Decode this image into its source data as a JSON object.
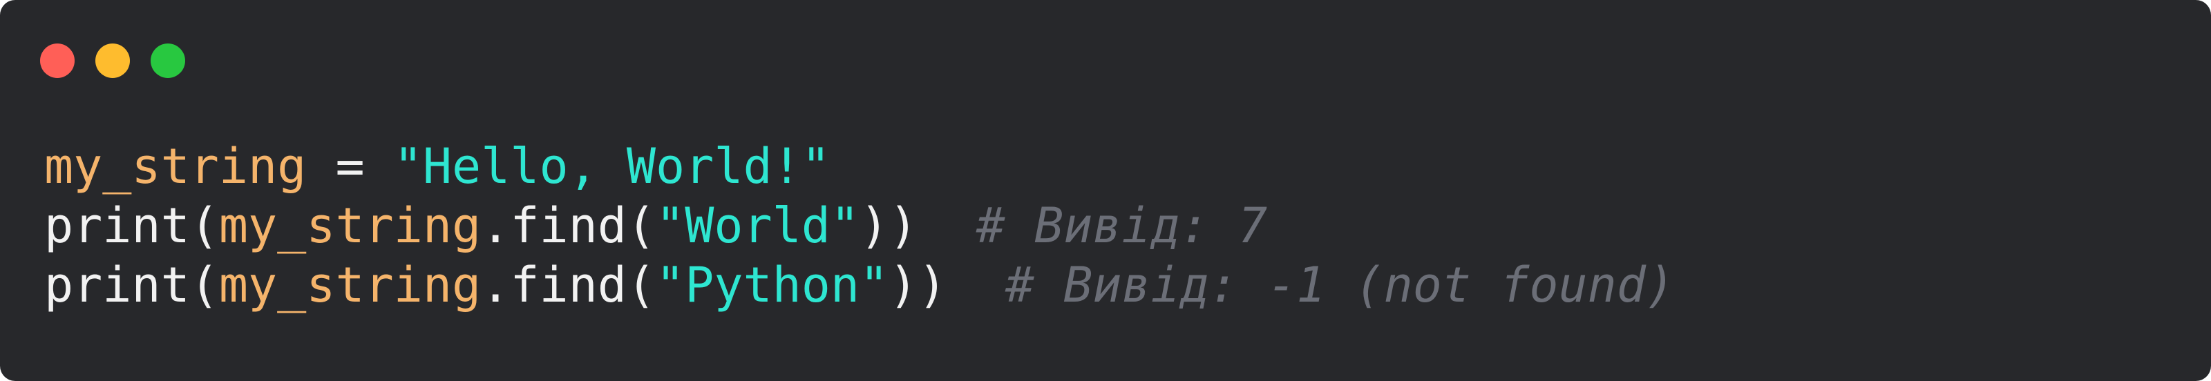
{
  "theme": {
    "background": "#27282b",
    "close_color": "#ff5f57",
    "minimize_color": "#febc2e",
    "maximize_color": "#28c840",
    "variable_color": "#f5b46b",
    "string_color": "#2ee6d1",
    "text_color": "#f2f2f2",
    "comment_color": "#6b6e77"
  },
  "window_controls": {
    "close": "close-button",
    "minimize": "minimize-button",
    "maximize": "maximize-button"
  },
  "code": {
    "line1": {
      "var": "my_string",
      "assign": " = ",
      "string": "\"Hello, World!\""
    },
    "line2": {
      "func": "print(",
      "var": "my_string",
      "method": ".find(",
      "string": "\"World\"",
      "close": "))",
      "spacer": "  ",
      "comment": "# Вивід: 7"
    },
    "line3": {
      "func": "print(",
      "var": "my_string",
      "method": ".find(",
      "string": "\"Python\"",
      "close": "))",
      "spacer": "  ",
      "comment": "# Вивід: -1 (not found)"
    }
  }
}
